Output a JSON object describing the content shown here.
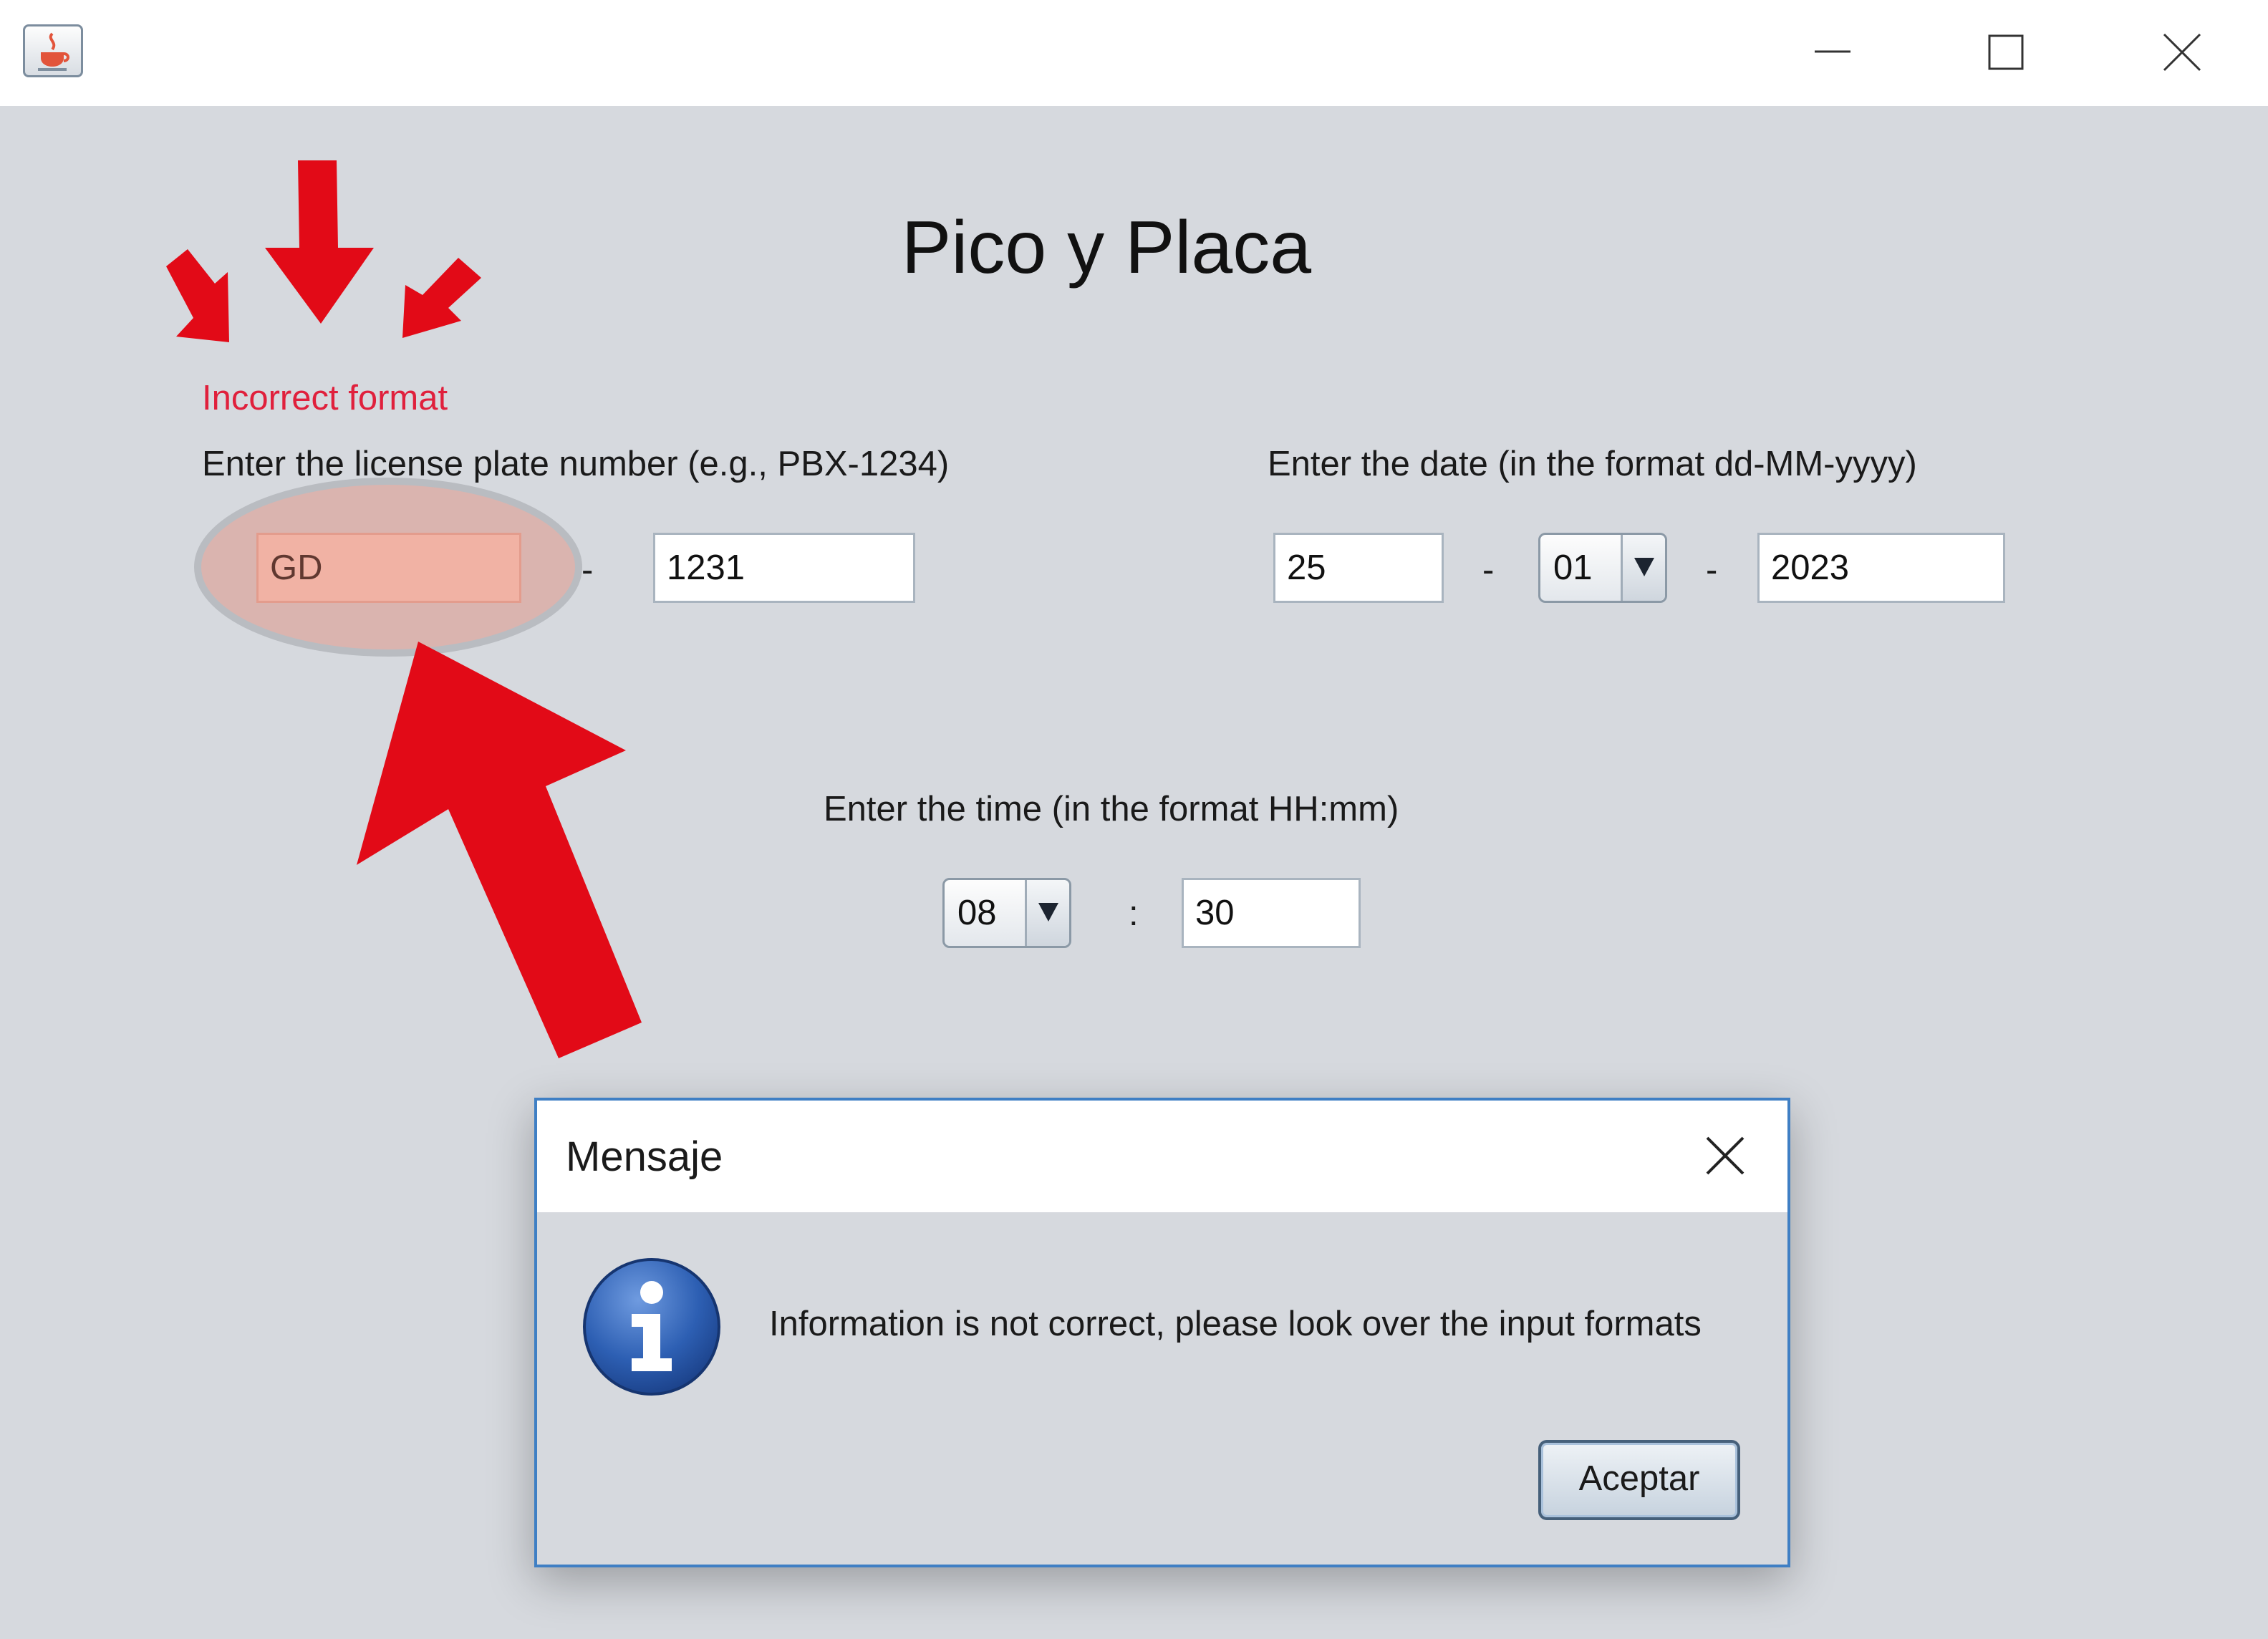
{
  "window": {
    "icon": "java-cup-icon",
    "controls": [
      "minimize-icon",
      "maximize-icon",
      "close-icon"
    ]
  },
  "app": {
    "title": "Pico y Placa"
  },
  "plate": {
    "error": "Incorrect format",
    "label": "Enter the license plate number (e.g., PBX-1234)",
    "letters": "GD",
    "separator": "-",
    "digits": "1231"
  },
  "date": {
    "label": "Enter the date (in the format dd-MM-yyyy)",
    "day": "25",
    "sep1": "-",
    "month": "01",
    "sep2": "-",
    "year": "2023"
  },
  "time": {
    "label": "Enter the time (in the format HH:mm)",
    "hour": "08",
    "sep": ":",
    "minute": "30"
  },
  "dialog": {
    "title": "Mensaje",
    "message": "Information is not correct, please look over the input formats",
    "accept": "Aceptar",
    "icon": "info-icon"
  },
  "colors": {
    "error_text": "#e0203c",
    "invalid_field": "#fad6cc",
    "annotation_red": "#e20a17",
    "dialog_border": "#3f7fc4"
  }
}
